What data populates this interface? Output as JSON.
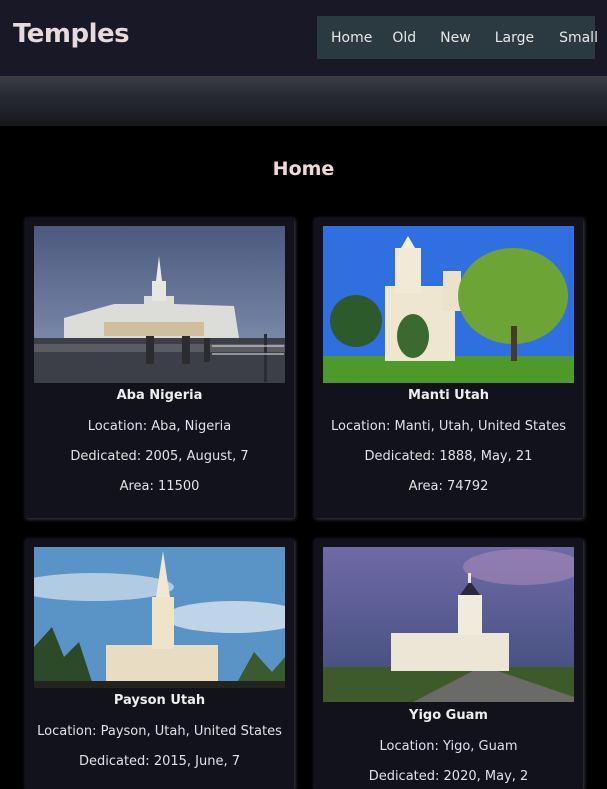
{
  "header": {
    "brand": "Temples",
    "nav": [
      "Home",
      "Old",
      "New",
      "Large",
      "Small"
    ]
  },
  "page": {
    "title": "Home"
  },
  "temples": [
    {
      "name": "Aba Nigeria",
      "location": "Location: Aba, Nigeria",
      "dedicated": "Dedicated: 2005, August, 7",
      "area": "Area: 11500"
    },
    {
      "name": "Manti Utah",
      "location": "Location: Manti, Utah, United States",
      "dedicated": "Dedicated: 1888, May, 21",
      "area": "Area: 74792"
    },
    {
      "name": "Payson Utah",
      "location": "Location: Payson, Utah, United States",
      "dedicated": "Dedicated: 2015, June, 7",
      "area": ""
    },
    {
      "name": "Yigo Guam",
      "location": "Location: Yigo, Guam",
      "dedicated": "Dedicated: 2020, May, 2",
      "area": ""
    }
  ]
}
